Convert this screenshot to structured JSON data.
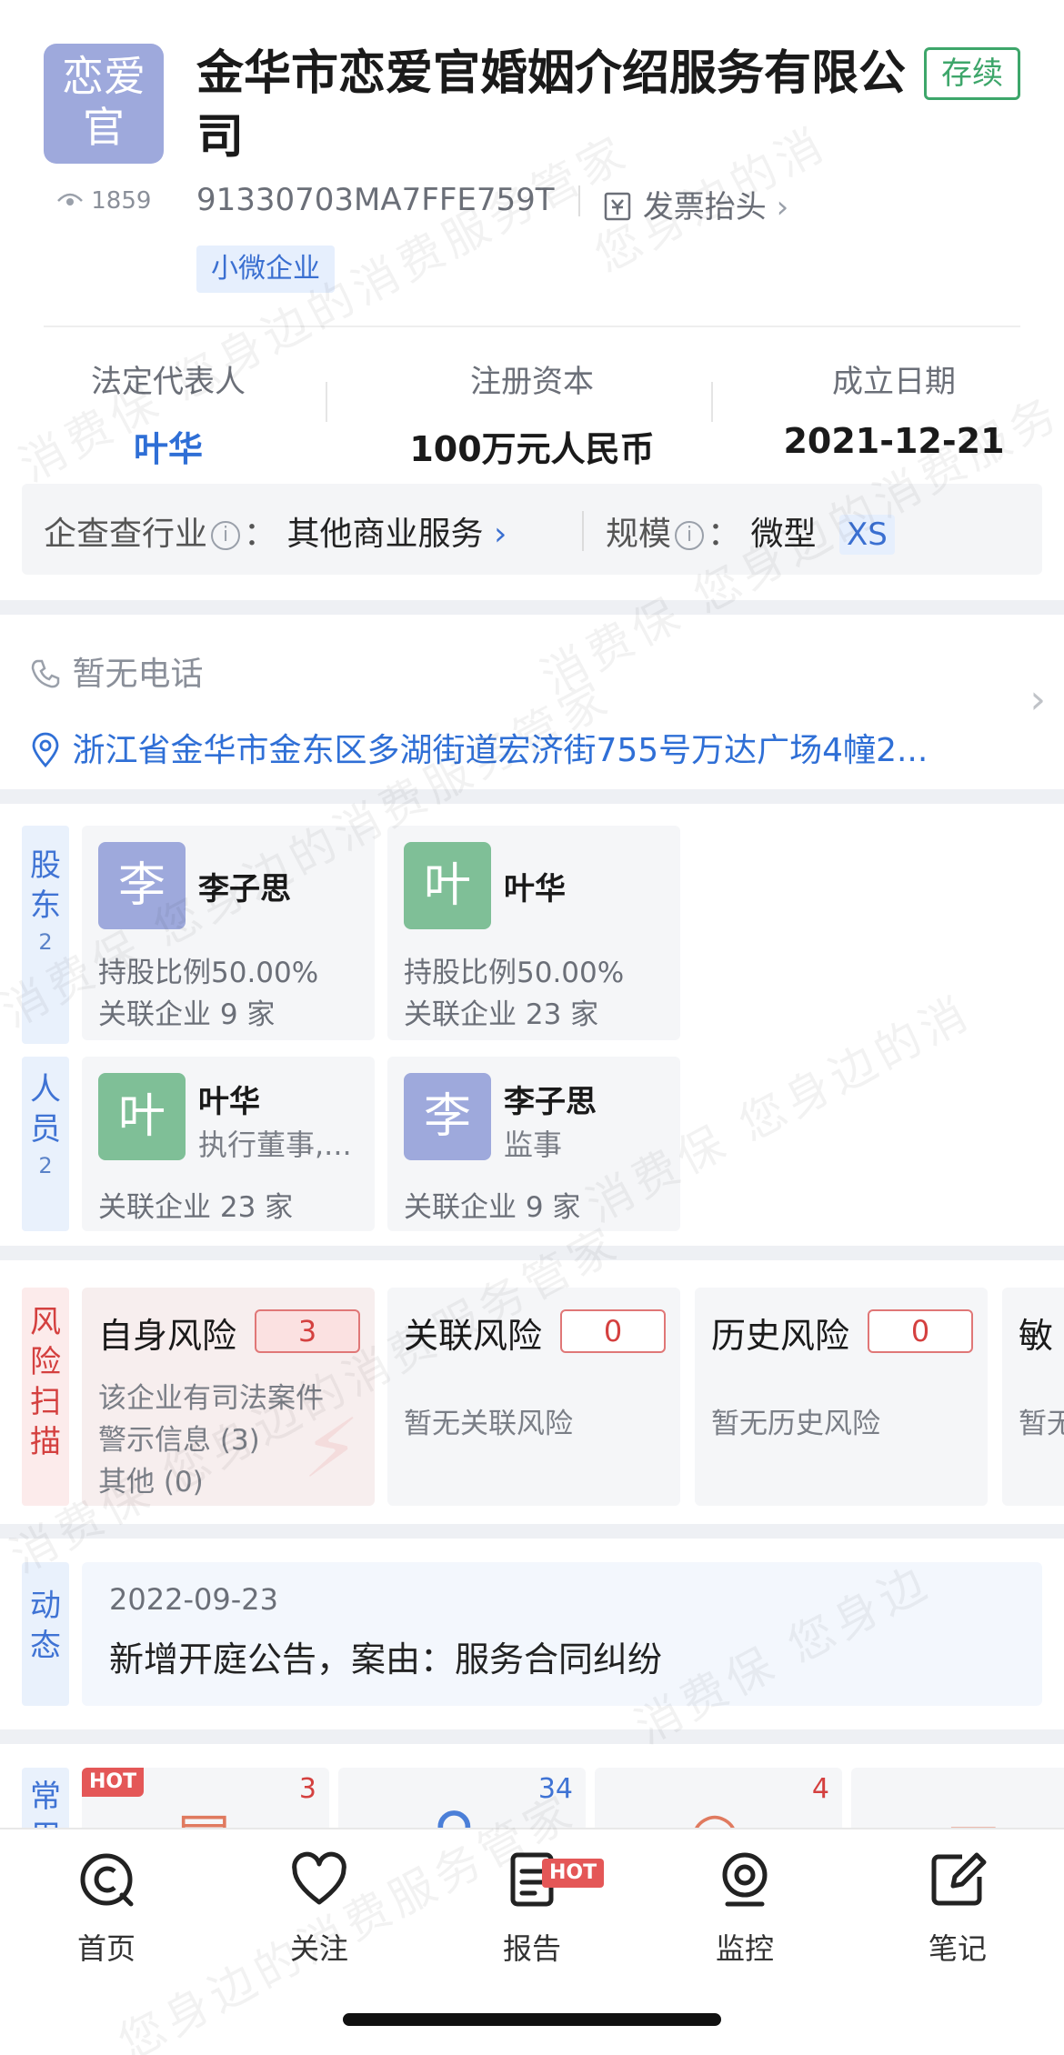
{
  "header": {
    "logo_text": "恋爱官",
    "views": "1859",
    "company_name": "金华市恋爱官婚姻介绍服务有限公司",
    "status": "存续",
    "credit_code": "91330703MA7FFE759T",
    "invoice_label": "发票抬头",
    "tag": "小微企业"
  },
  "stats": [
    {
      "label": "法定代表人",
      "value": "叶华"
    },
    {
      "label": "注册资本",
      "value": "100万元人民币"
    },
    {
      "label": "成立日期",
      "value": "2021-12-21"
    }
  ],
  "industry": {
    "label": "企查查行业",
    "value": "其他商业服务",
    "scale_label": "规模",
    "scale_value": "微型",
    "scale_tag": "XS"
  },
  "contact": {
    "phone": "暂无电话",
    "address": "浙江省金华市金东区多湖街道宏济街755号万达广场4幢2..."
  },
  "shareholders": {
    "label": "股东",
    "count": "2",
    "items": [
      {
        "avatar": "李",
        "name": "李子思",
        "ratio": "持股比例50.00%",
        "related": "关联企业 9 家"
      },
      {
        "avatar": "叶",
        "name": "叶华",
        "ratio": "持股比例50.00%",
        "related": "关联企业 23 家"
      }
    ]
  },
  "staff": {
    "label": "人员",
    "count": "2",
    "items": [
      {
        "avatar": "叶",
        "name": "叶华",
        "role": "执行董事,...",
        "related": "关联企业 23 家"
      },
      {
        "avatar": "李",
        "name": "李子思",
        "role": "监事",
        "related": "关联企业 9 家"
      }
    ]
  },
  "risk": {
    "label": "风险扫描",
    "items": [
      {
        "title": "自身风险",
        "count": "3",
        "lines": [
          "该企业有司法案件",
          "警示信息 (3)",
          "其他 (0)"
        ]
      },
      {
        "title": "关联风险",
        "count": "0",
        "lines": [
          "暂无关联风险"
        ]
      },
      {
        "title": "历史风险",
        "count": "0",
        "lines": [
          "暂无历史风险"
        ]
      },
      {
        "title": "敏",
        "count": "",
        "lines": [
          "暂无"
        ]
      }
    ]
  },
  "dynamics": {
    "label": "动态",
    "date": "2022-09-23",
    "text": "新增开庭公告，案由：服务合同纠纷"
  },
  "tools": {
    "label": "常用",
    "hot": "HOT",
    "counts": [
      "3",
      "34",
      "4",
      ""
    ]
  },
  "nav": [
    {
      "label": "首页"
    },
    {
      "label": "关注"
    },
    {
      "label": "报告",
      "badge": "HOT"
    },
    {
      "label": "监控"
    },
    {
      "label": "笔记"
    }
  ],
  "colors": {
    "accent": "#2f6fd6",
    "risk": "#d4403f",
    "status": "#3da66a"
  }
}
